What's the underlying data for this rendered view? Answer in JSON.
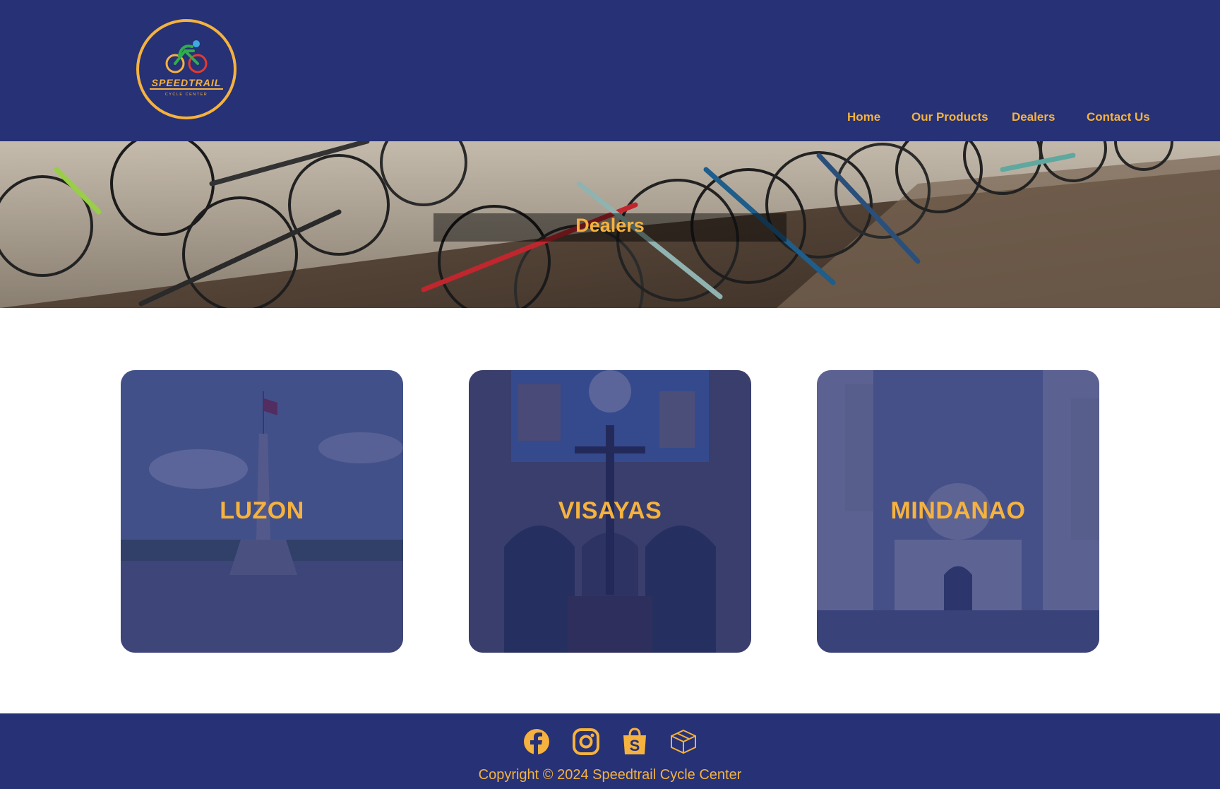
{
  "brand": {
    "logo_word": "SPEEDTRAIL",
    "logo_sub": "CYCLE CENTER"
  },
  "nav": {
    "items": [
      {
        "label": "Home"
      },
      {
        "label": "Our Products"
      },
      {
        "label": "Dealers"
      },
      {
        "label": "Contact Us"
      }
    ]
  },
  "hero": {
    "title": "Dealers"
  },
  "regions": [
    {
      "label": "LUZON"
    },
    {
      "label": "VISAYAS"
    },
    {
      "label": "MINDANAO"
    }
  ],
  "footer": {
    "social": [
      "facebook-icon",
      "instagram-icon",
      "shopee-icon",
      "lazada-box-icon"
    ],
    "copyright": "Copyright © 2024 Speedtrail Cycle Center"
  },
  "colors": {
    "navy": "#263176",
    "accent": "#f5b23e"
  }
}
